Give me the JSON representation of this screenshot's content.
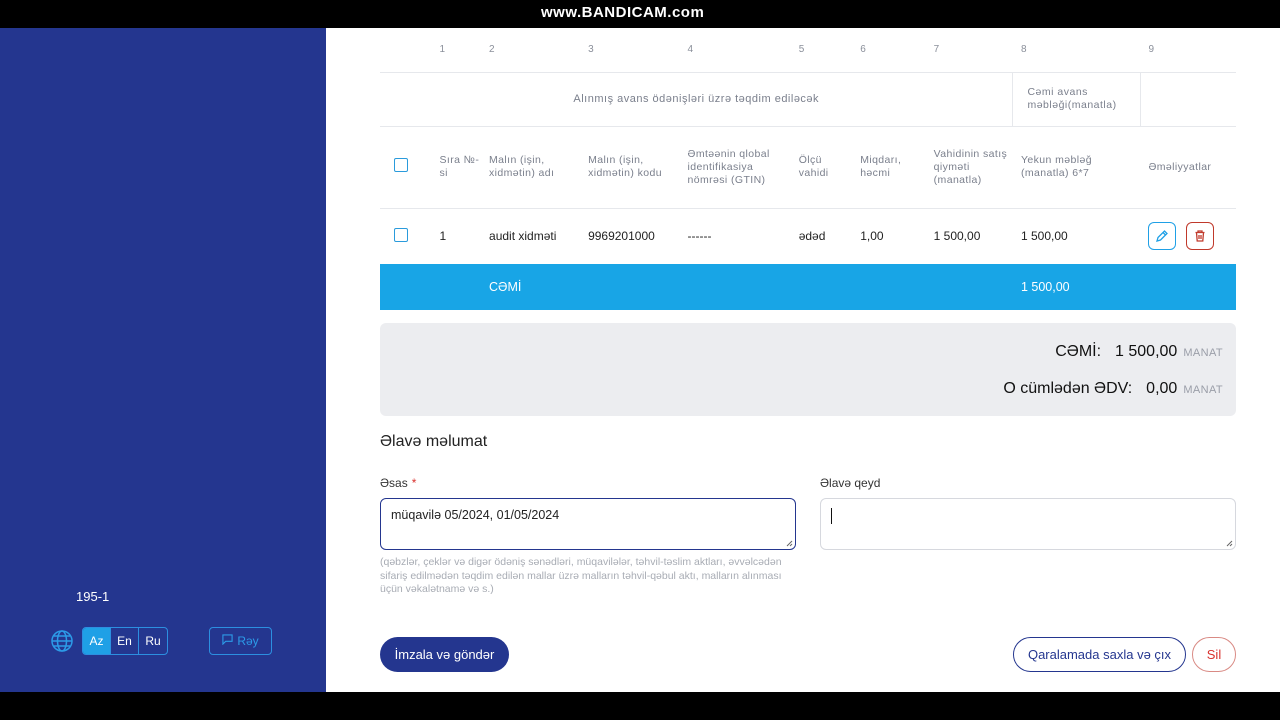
{
  "overlay": {
    "watermark": "www.BANDICAM.com"
  },
  "sidebar": {
    "version": "195-1",
    "languages": [
      {
        "label": "Az",
        "active": true
      },
      {
        "label": "En",
        "active": false
      },
      {
        "label": "Ru",
        "active": false
      }
    ],
    "feedback_label": "Rəy"
  },
  "table": {
    "column_numbers": [
      "1",
      "2",
      "3",
      "4",
      "5",
      "6",
      "7",
      "8",
      "9"
    ],
    "group_header": "Alınmış avans ödənişləri üzrə təqdim ediləcək",
    "group_header_total": "Cəmi avans məbləği(manatla)",
    "columns": {
      "seq": "Sıra №-si",
      "name": "Malın (işin, xidmətin) adı",
      "code": "Malın (işin, xidmətin) kodu",
      "gtin": "Əmtəənin qlobal identifikasiya nömrəsi (GTIN)",
      "unit": "Ölçü vahidi",
      "qty": "Miqdarı, həcmi",
      "price": "Vahidinin satış qiyməti (manatla)",
      "total": "Yekun məbləğ (manatla) 6*7",
      "actions": "Əməliyyatlar"
    },
    "rows": [
      {
        "seq": "1",
        "name": "audit xidməti",
        "code": "9969201000",
        "gtin": "------",
        "unit": "ədəd",
        "qty": "1,00",
        "price": "1 500,00",
        "total": "1 500,00"
      }
    ],
    "total_row": {
      "label": "CƏMİ",
      "total": "1 500,00"
    }
  },
  "summary": {
    "total_label": "CƏMİ:",
    "total_value": "1 500,00",
    "vat_label": "O cümlədən ƏDV:",
    "vat_value": "0,00",
    "currency": "MANAT"
  },
  "additional": {
    "title": "Əlavə məlumat",
    "basis_label": "Əsas",
    "basis_value": "müqavilə 05/2024, 01/05/2024",
    "note_label": "Əlavə qeyd",
    "note_value": "",
    "hint": "(qəbzlər, çeklər və digər ödəniş sənədləri, müqavilələr, təhvil-təslim aktları, əvvəlcədən sifariş edilmədən təqdim edilən mallar üzrə malların təhvil-qəbul aktı, malların alınması üçün vəkalətnamə və s.)"
  },
  "actions": {
    "sign_send": "İmzala və göndər",
    "save_draft": "Qaralamada saxla və çıx",
    "delete": "Sil"
  },
  "colors": {
    "sidebar": "#24368f",
    "accent": "#18a5e6",
    "danger": "#d9322e"
  }
}
